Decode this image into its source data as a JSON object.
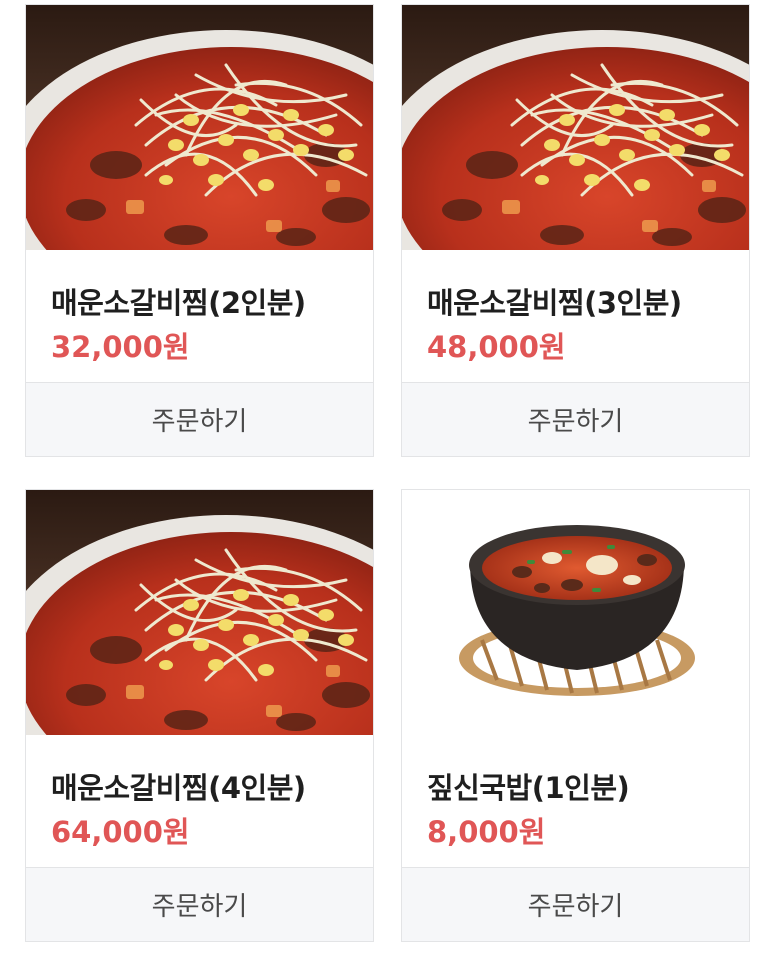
{
  "colors": {
    "price": "#e05656",
    "name": "#1f1f1f",
    "button_bg": "#f6f7f9",
    "border": "#e3e4e6"
  },
  "products": [
    {
      "name": "매운소갈비찜(2인분)",
      "price": "32,000원",
      "button": "주문하기",
      "image": "braised-short-rib-photo"
    },
    {
      "name": "매운소갈비찜(3인분)",
      "price": "48,000원",
      "button": "주문하기",
      "image": "braised-short-rib-photo"
    },
    {
      "name": "매운소갈비찜(4인분)",
      "price": "64,000원",
      "button": "주문하기",
      "image": "braised-short-rib-photo"
    },
    {
      "name": "짚신국밥(1인분)",
      "price": "8,000원",
      "button": "주문하기",
      "image": "gukbap-bowl-photo"
    }
  ]
}
